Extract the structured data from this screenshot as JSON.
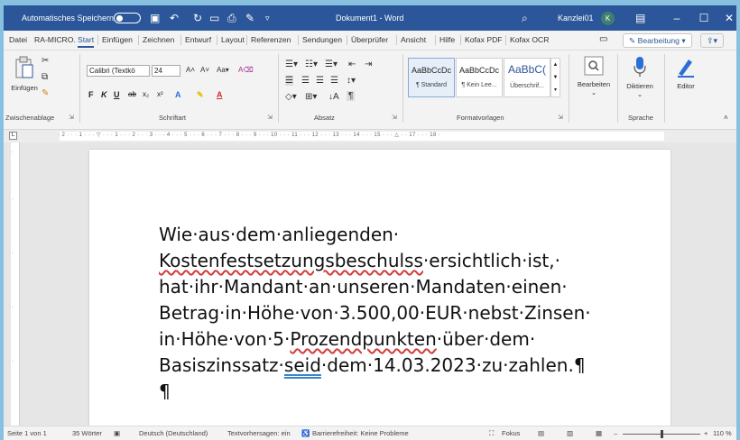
{
  "titlebar": {
    "autosave_label": "Automatisches Speichern",
    "doc_title": "Dokument1 - Word",
    "account_name": "Kanzlei01",
    "avatar_initial": "K"
  },
  "tabs": [
    "Datei",
    "RA-MICRO.",
    "Start",
    "Einfügen",
    "Zeichnen",
    "Entwurf",
    "Layout",
    "Referenzen",
    "Sendungen",
    "Überprüfer",
    "Ansicht",
    "Hilfe",
    "Kofax PDF",
    "Kofax OCR"
  ],
  "active_tab": "Start",
  "edit_mode": "Bearbeitung",
  "ribbon": {
    "clipboard": {
      "paste": "Einfügen",
      "label": "Zwischenablage"
    },
    "font": {
      "name": "Calibri (Textkö",
      "size": "24",
      "label": "Schriftart"
    },
    "paragraph": {
      "label": "Absatz"
    },
    "styles": {
      "items": [
        {
          "preview": "AaBbCcDc",
          "name": "¶ Standard"
        },
        {
          "preview": "AaBbCcDc",
          "name": "¶ Kein Lee..."
        },
        {
          "preview": "AaBbC(",
          "name": "Überschrif..."
        }
      ],
      "label": "Formatvorlagen"
    },
    "editing": {
      "label": "Bearbeiten"
    },
    "voice": {
      "dictate": "Diktieren",
      "label": "Sprache"
    },
    "editor": {
      "label": "Editor"
    }
  },
  "ruler_text": "· 2 · · · 1 · · · ▽ · · · 1 · · · 2 · · · 3 · · · 4 · · · 5 · · · 6 · · · 7 · · · 8 · · · 9 · · · 10 · · · 11 · · · 12 · · · 13 · · · 14 · · · 15 · · · △ · · 17 · · · 18 ·",
  "document": {
    "lines": [
      [
        {
          "t": "Wie·aus·dem·anliegenden·"
        }
      ],
      [
        {
          "t": "Kostenfestsetzungsbeschulss",
          "mark": "spell"
        },
        {
          "t": "·ersichtlich·ist,·"
        }
      ],
      [
        {
          "t": "hat·ihr·Mandant·an·unseren·Mandaten·einen·"
        }
      ],
      [
        {
          "t": "Betrag·in·Höhe·von·3.500,00·EUR·nebst·Zinsen·"
        }
      ],
      [
        {
          "t": "in·Höhe·von·5·"
        },
        {
          "t": "Prozendpunkten",
          "mark": "spell"
        },
        {
          "t": "·über·dem·"
        }
      ],
      [
        {
          "t": "Basiszinssatz·"
        },
        {
          "t": "seid",
          "mark": "gram"
        },
        {
          "t": "·dem·14.03.2023·zu·zahlen.¶"
        }
      ],
      [
        {
          "t": "¶"
        }
      ]
    ]
  },
  "status": {
    "page": "Seite 1 von 1",
    "words": "35 Wörter",
    "language": "Deutsch (Deutschland)",
    "predictions": "Textvorhersagen: ein",
    "accessibility": "Barrierefreiheit: Keine Probleme",
    "focus": "Fokus",
    "zoom": "110 %"
  },
  "colors": {
    "title_bar": "#2b579a",
    "spell_underline": "#d23c3c",
    "grammar_underline": "#3d86c6"
  }
}
